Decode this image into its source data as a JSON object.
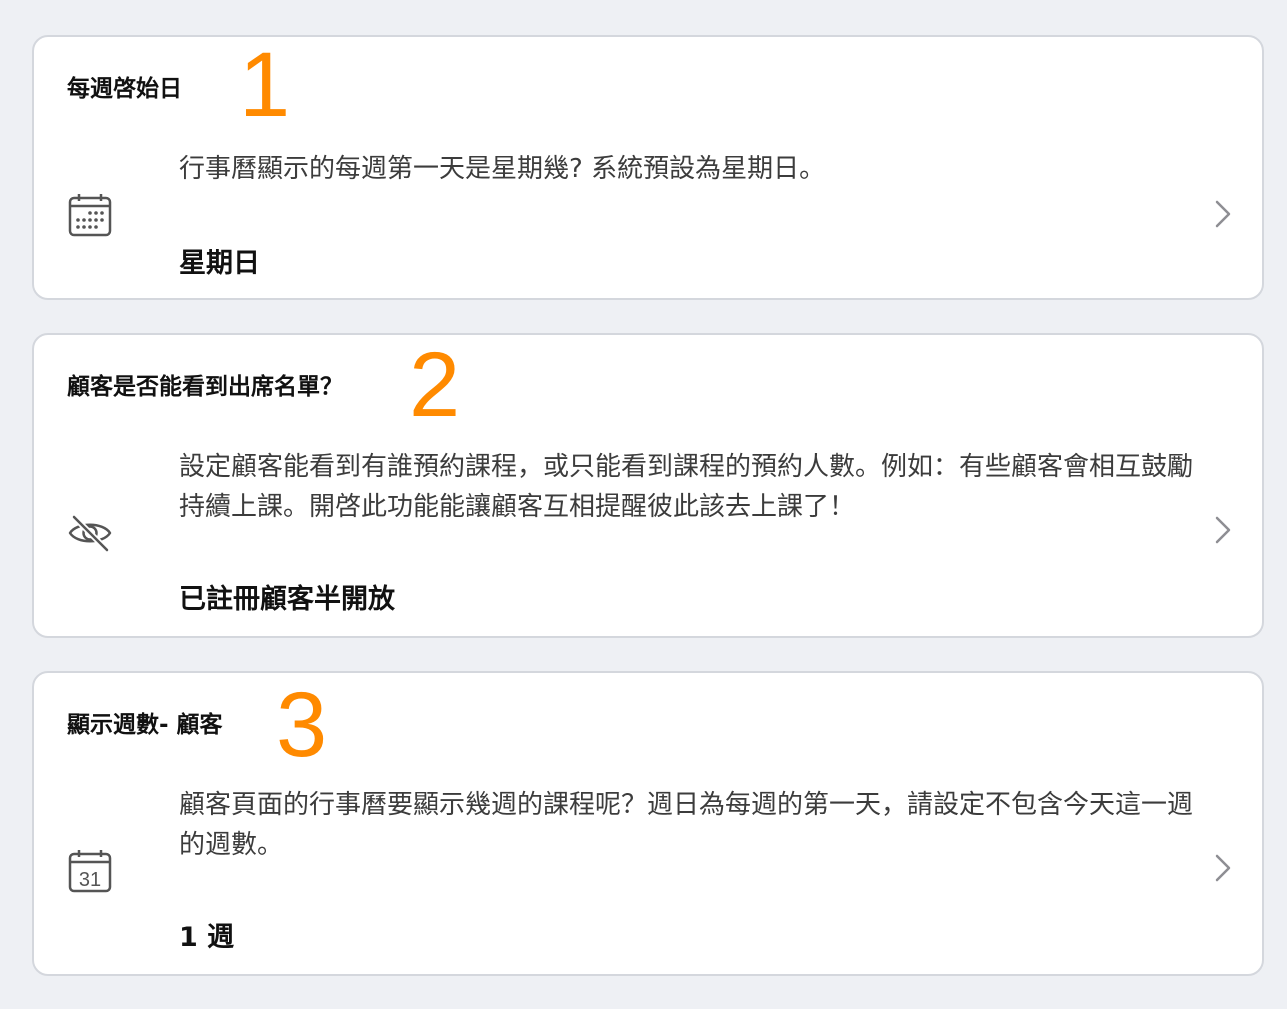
{
  "settings": [
    {
      "title": "每週啓始日",
      "step_number": "1",
      "description": "行事曆顯示的每週第一天是星期幾? 系統預設為星期日。",
      "value": "星期日",
      "icon": "calendar-grid-icon"
    },
    {
      "title": "顧客是否能看到出席名單？",
      "step_number": "2",
      "description": "設定顧客能看到有誰預約課程，或只能看到課程的預約人數。例如：有些顧客會相互鼓勵持續上課。開啓此功能能讓顧客互相提醒彼此該去上課了！",
      "value": "已註冊顧客半開放",
      "icon": "eye-off-icon"
    },
    {
      "title": "顯示週數- 顧客",
      "step_number": "3",
      "description": "顧客頁面的行事曆要顯示幾週的課程呢？週日為每週的第一天，請設定不包含今天這一週的週數。",
      "value": "1 週",
      "icon": "calendar-31-icon",
      "icon_text": "31"
    }
  ],
  "colors": {
    "background": "#eef0f4",
    "card": "#ffffff",
    "card_border": "#d4d7dd",
    "annotation": "#ff8a00",
    "chevron": "#8e8e93"
  }
}
